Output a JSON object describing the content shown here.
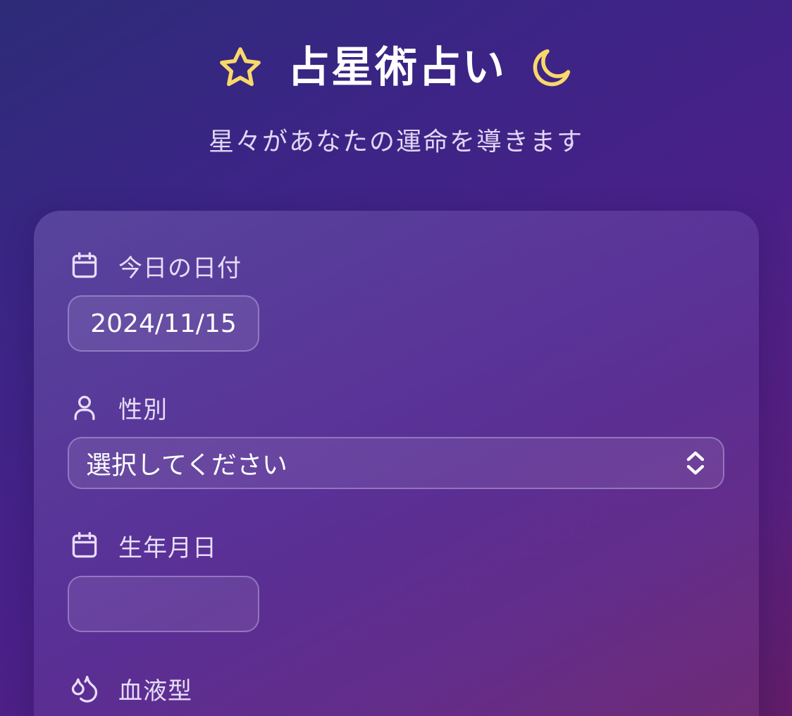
{
  "header": {
    "title": "占星術占い",
    "subtitle": "星々があなたの運命を導きます",
    "icons": [
      "star-icon",
      "moon-icon"
    ],
    "accent_color": "#f9d86a"
  },
  "form": {
    "today_date": {
      "label": "今日の日付",
      "icon": "calendar-icon",
      "value": "2024/11/15"
    },
    "gender": {
      "label": "性別",
      "icon": "user-icon",
      "selected": "選択してください"
    },
    "birth_date": {
      "label": "生年月日",
      "icon": "calendar-icon",
      "value": ""
    },
    "blood_type": {
      "label": "血液型",
      "icon": "droplets-icon"
    }
  }
}
